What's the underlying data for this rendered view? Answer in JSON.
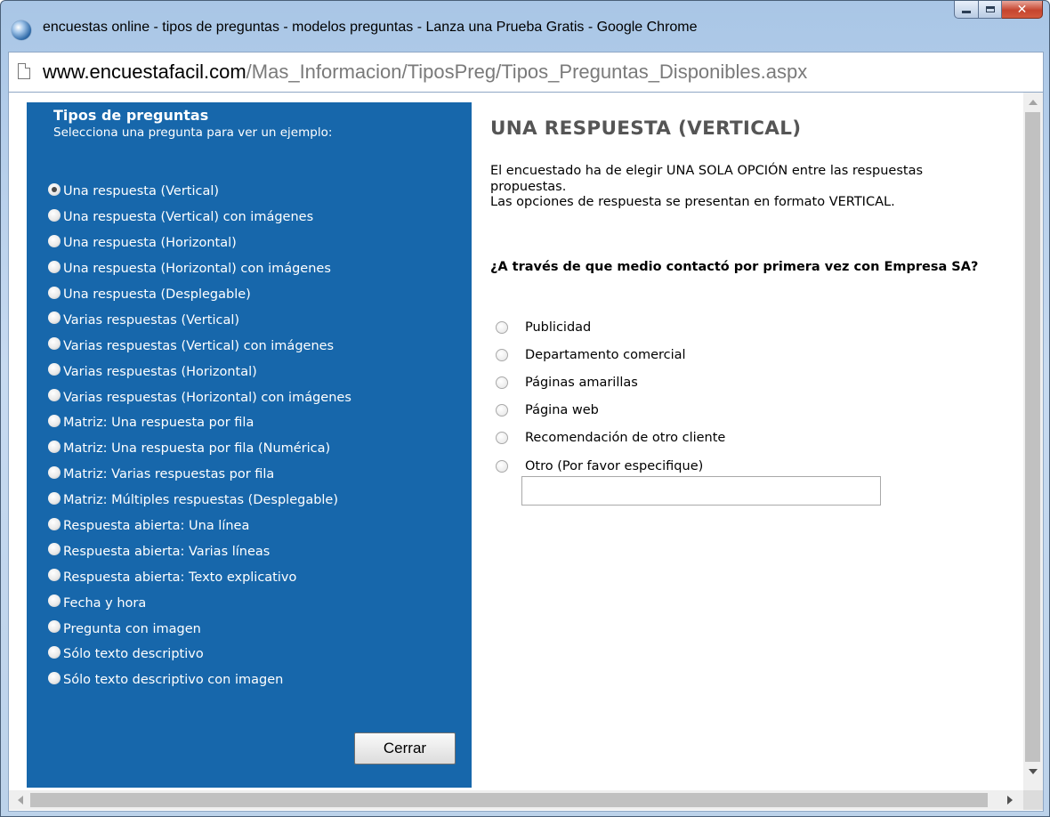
{
  "window": {
    "title": "encuestas online - tipos de preguntas - modelos preguntas - Lanza una Prueba Gratis - Google Chrome",
    "controls": {
      "minimize": "minimize-icon",
      "maximize": "maximize-icon",
      "close": "close-icon"
    }
  },
  "address": {
    "domain": "www.encuestafacil.com",
    "path": "/Mas_Informacion/TiposPreg/Tipos_Preguntas_Disponibles.aspx"
  },
  "sidebar": {
    "heading": "Tipos de preguntas",
    "subheading": "Selecciona una pregunta para ver un ejemplo:",
    "selected_index": 0,
    "items": [
      {
        "label": "Una respuesta (Vertical)"
      },
      {
        "label": "Una respuesta (Vertical) con imágenes"
      },
      {
        "label": "Una respuesta (Horizontal)"
      },
      {
        "label": "Una respuesta (Horizontal) con imágenes"
      },
      {
        "label": "Una respuesta (Desplegable)"
      },
      {
        "label": "Varias respuestas (Vertical)"
      },
      {
        "label": "Varias respuestas (Vertical) con imágenes"
      },
      {
        "label": "Varias respuestas (Horizontal)"
      },
      {
        "label": "Varias respuestas (Horizontal) con imágenes"
      },
      {
        "label": "Matriz: Una respuesta por fila"
      },
      {
        "label": "Matriz: Una respuesta por fila (Numérica)"
      },
      {
        "label": "Matriz: Varias respuestas por fila"
      },
      {
        "label": "Matriz: Múltiples respuestas (Desplegable)"
      },
      {
        "label": "Respuesta abierta: Una línea"
      },
      {
        "label": "Respuesta abierta: Varias líneas"
      },
      {
        "label": "Respuesta abierta: Texto explicativo"
      },
      {
        "label": "Fecha y hora"
      },
      {
        "label": "Pregunta con imagen"
      },
      {
        "label": "Sólo texto descriptivo"
      },
      {
        "label": "Sólo texto descriptivo con imagen"
      }
    ],
    "close_label": "Cerrar",
    "background": "#1767ab"
  },
  "detail": {
    "title": "UNA RESPUESTA (VERTICAL)",
    "desc_line1": "El encuestado ha de elegir UNA SOLA OPCIÓN entre las respuestas propuestas.",
    "desc_line2": "Las opciones de respuesta se presentan en formato VERTICAL.",
    "question": "¿A través de que medio contactó por primera vez con Empresa SA?",
    "options": [
      {
        "label": "Publicidad"
      },
      {
        "label": "Departamento comercial"
      },
      {
        "label": "Páginas amarillas"
      },
      {
        "label": "Página web"
      },
      {
        "label": "Recomendación de otro cliente"
      },
      {
        "label": "Otro (Por favor especifique)"
      }
    ],
    "other_value": ""
  }
}
